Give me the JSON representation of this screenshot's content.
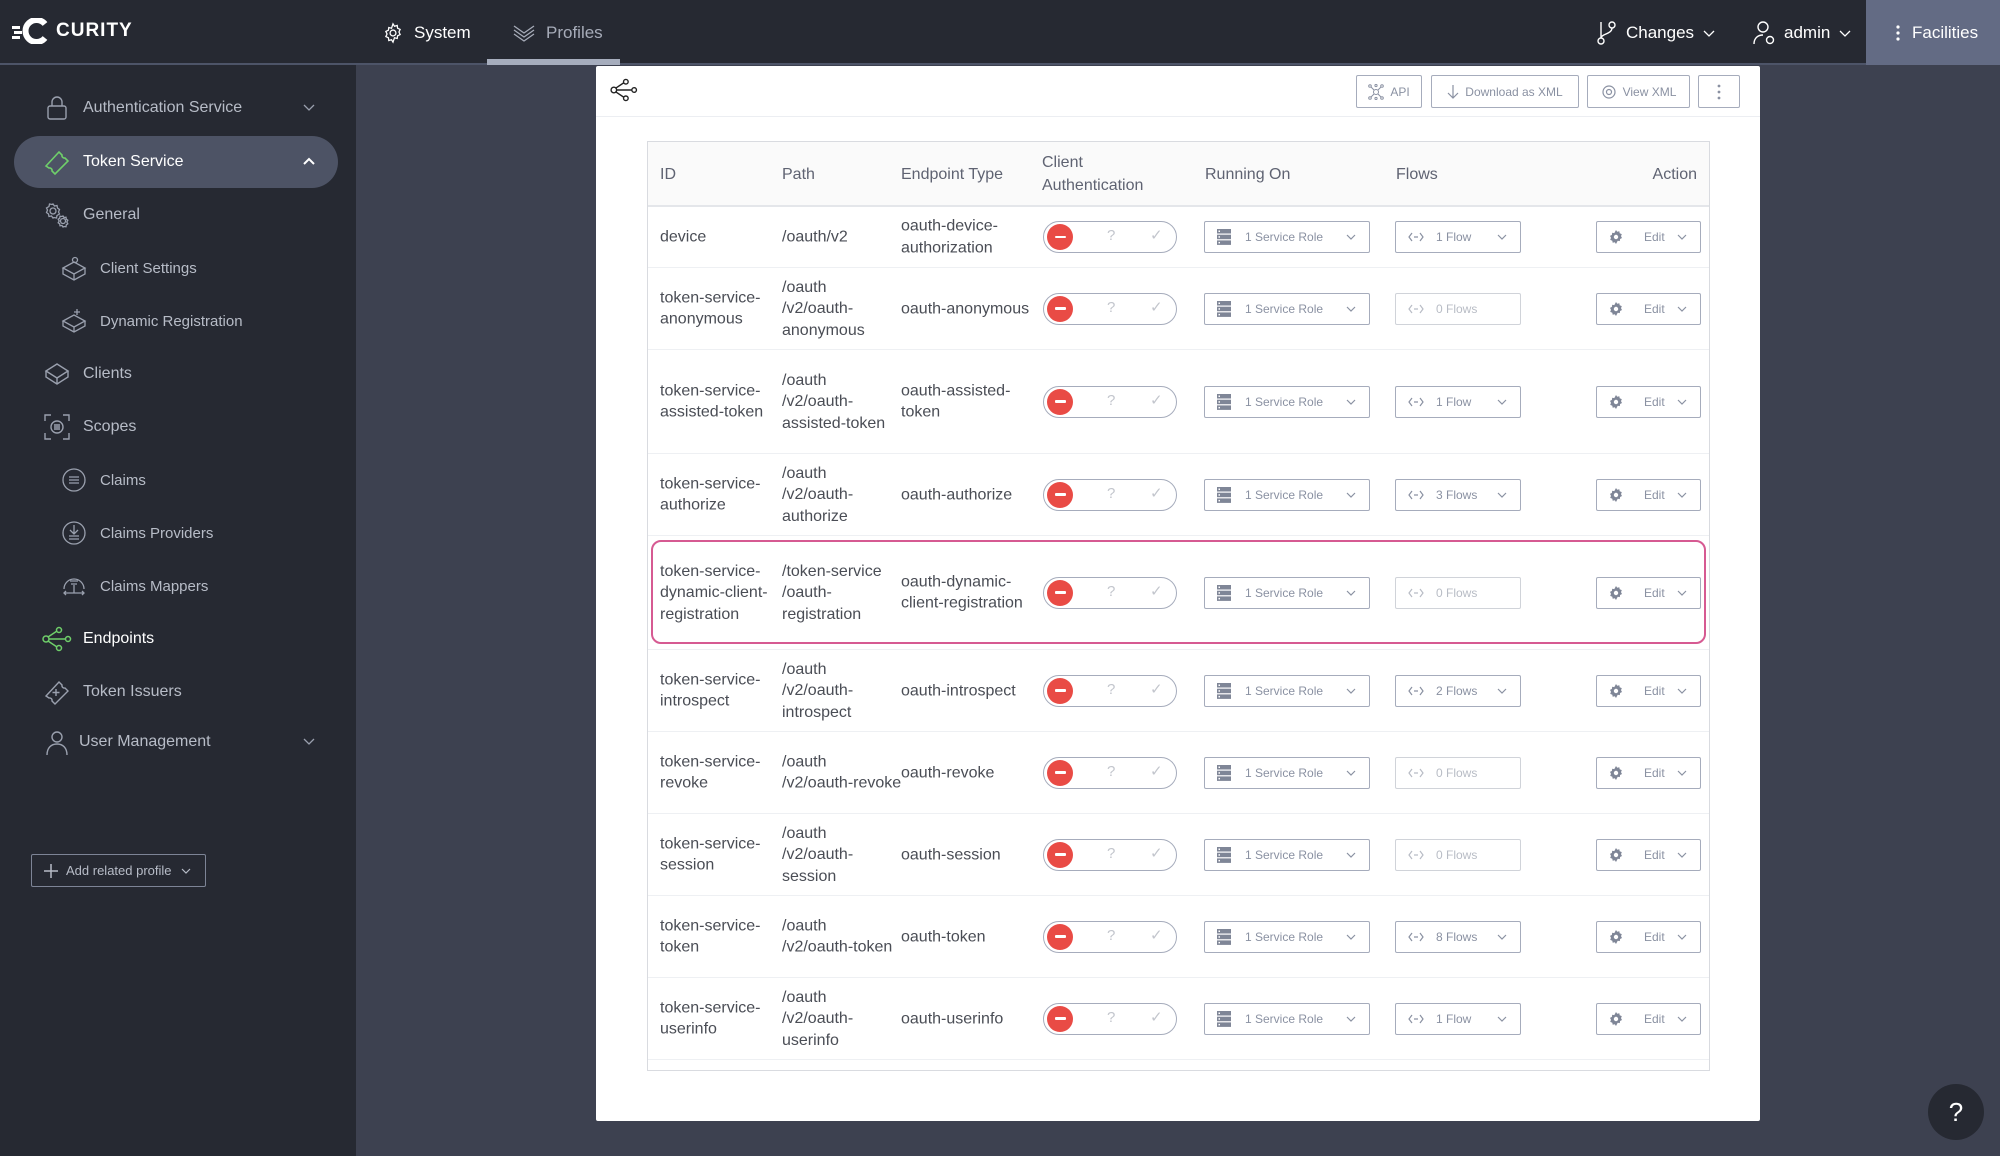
{
  "brand": "CURITY",
  "topbar": {
    "system_label": "System",
    "profiles_label": "Profiles",
    "changes_label": "Changes",
    "user_label": "admin",
    "facilities_label": "Facilities"
  },
  "sidebar": {
    "items": [
      {
        "label": "Authentication Service",
        "icon": "lock-icon",
        "level": 0,
        "expandable": "collapsed"
      },
      {
        "label": "Token Service",
        "icon": "ticket-icon",
        "level": 0,
        "expandable": "expanded",
        "active": true
      },
      {
        "label": "General",
        "icon": "gears-icon",
        "level": 0
      },
      {
        "label": "Client Settings",
        "icon": "box-gear-icon",
        "level": 1
      },
      {
        "label": "Dynamic Registration",
        "icon": "box-plus-icon",
        "level": 1
      },
      {
        "label": "Clients",
        "icon": "box-icon",
        "level": 0
      },
      {
        "label": "Scopes",
        "icon": "scope-icon",
        "level": 0
      },
      {
        "label": "Claims",
        "icon": "list-circle-icon",
        "level": 1
      },
      {
        "label": "Claims Providers",
        "icon": "download-circle-icon",
        "level": 1
      },
      {
        "label": "Claims Mappers",
        "icon": "mapper-icon",
        "level": 1
      },
      {
        "label": "Endpoints",
        "icon": "endpoints-icon",
        "level": 0,
        "current": true
      },
      {
        "label": "Token Issuers",
        "icon": "ticket-plus-icon",
        "level": 0
      },
      {
        "label": "User Management",
        "icon": "user-icon",
        "level": 0,
        "expandable": "collapsed"
      }
    ],
    "add_profile_label": "Add related profile"
  },
  "card": {
    "buttons": {
      "api": "API",
      "download": "Download as XML",
      "view": "View XML"
    }
  },
  "table": {
    "headers": {
      "id": "ID",
      "path": "Path",
      "type": "Endpoint Type",
      "client_auth": "Client Authentication",
      "running_on": "Running On",
      "flows": "Flows",
      "action": "Action"
    },
    "rows": [
      {
        "id": "device",
        "path": "/oauth/v2",
        "type": "oauth-device-authorization",
        "running_on": "1 Service Role",
        "flows": "1 Flow",
        "flows_enabled": true,
        "action": "Edit"
      },
      {
        "id": "token-service-anonymous",
        "path": "/oauth /v2/oauth-anonymous",
        "type": "oauth-anonymous",
        "running_on": "1 Service Role",
        "flows": "0 Flows",
        "flows_enabled": false,
        "action": "Edit"
      },
      {
        "id": "token-service-assisted-token",
        "path": "/oauth /v2/oauth-assisted-token",
        "type": "oauth-assisted-token",
        "running_on": "1 Service Role",
        "flows": "1 Flow",
        "flows_enabled": true,
        "action": "Edit"
      },
      {
        "id": "token-service-authorize",
        "path": "/oauth /v2/oauth-authorize",
        "type": "oauth-authorize",
        "running_on": "1 Service Role",
        "flows": "3 Flows",
        "flows_enabled": true,
        "action": "Edit"
      },
      {
        "id": "token-service-dynamic-client-registration",
        "path": "/token-service /oauth-registration",
        "type": "oauth-dynamic-client-registration",
        "running_on": "1 Service Role",
        "flows": "0 Flows",
        "flows_enabled": false,
        "action": "Edit",
        "highlighted": true
      },
      {
        "id": "token-service-introspect",
        "path": "/oauth /v2/oauth-introspect",
        "type": "oauth-introspect",
        "running_on": "1 Service Role",
        "flows": "2 Flows",
        "flows_enabled": true,
        "action": "Edit"
      },
      {
        "id": "token-service-revoke",
        "path": "/oauth /v2/oauth-revoke",
        "type": "oauth-revoke",
        "running_on": "1 Service Role",
        "flows": "0 Flows",
        "flows_enabled": false,
        "action": "Edit"
      },
      {
        "id": "token-service-session",
        "path": "/oauth /v2/oauth-session",
        "type": "oauth-session",
        "running_on": "1 Service Role",
        "flows": "0 Flows",
        "flows_enabled": false,
        "action": "Edit"
      },
      {
        "id": "token-service-token",
        "path": "/oauth /v2/oauth-token",
        "type": "oauth-token",
        "running_on": "1 Service Role",
        "flows": "8 Flows",
        "flows_enabled": true,
        "action": "Edit"
      },
      {
        "id": "token-service-userinfo",
        "path": "/oauth /v2/oauth-userinfo",
        "type": "oauth-userinfo",
        "running_on": "1 Service Role",
        "flows": "1 Flow",
        "flows_enabled": true,
        "action": "Edit"
      }
    ],
    "client_auth_state": "deny",
    "client_auth_options": [
      "deny",
      "unknown",
      "allow"
    ]
  },
  "help_label": "?",
  "colors": {
    "accent_green": "#6fcf6a",
    "deny_red": "#e94b45",
    "highlight_pink": "#d65a92",
    "topbar_bg": "#262932",
    "facilities_bg": "#636b84"
  }
}
